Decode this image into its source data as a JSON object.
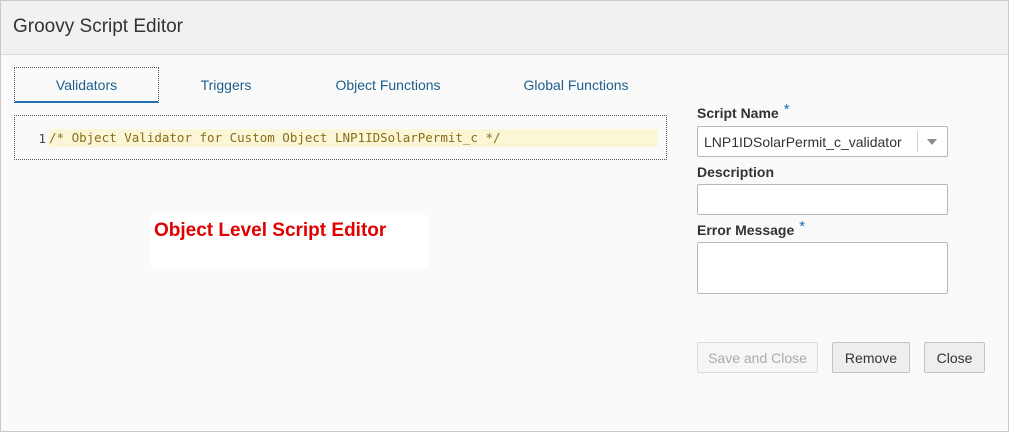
{
  "dialog": {
    "title": "Groovy Script Editor"
  },
  "tabs": [
    {
      "label": "Validators",
      "active": true
    },
    {
      "label": "Triggers",
      "active": false
    },
    {
      "label": "Object Functions",
      "active": false
    },
    {
      "label": "Global Functions",
      "active": false
    }
  ],
  "editor": {
    "lines": [
      {
        "number": "1",
        "code": "/* Object Validator for Custom Object LNP1IDSolarPermit_c */"
      }
    ]
  },
  "annotation": {
    "text": "Object Level Script Editor",
    "color": "#e00000"
  },
  "form": {
    "script_name_label": "Script Name",
    "required_marker": "*",
    "script_name_value": "LNP1IDSolarPermit_c_validator",
    "description_label": "Description",
    "description_value": "",
    "error_message_label": "Error Message",
    "error_message_value": ""
  },
  "buttons": {
    "save_close": "Save and Close",
    "remove": "Remove",
    "close": "Close"
  },
  "icons": {
    "dropdown": "chevron-down-icon"
  },
  "colors": {
    "accent": "#1f6fb2",
    "link": "#1e5f8c"
  }
}
